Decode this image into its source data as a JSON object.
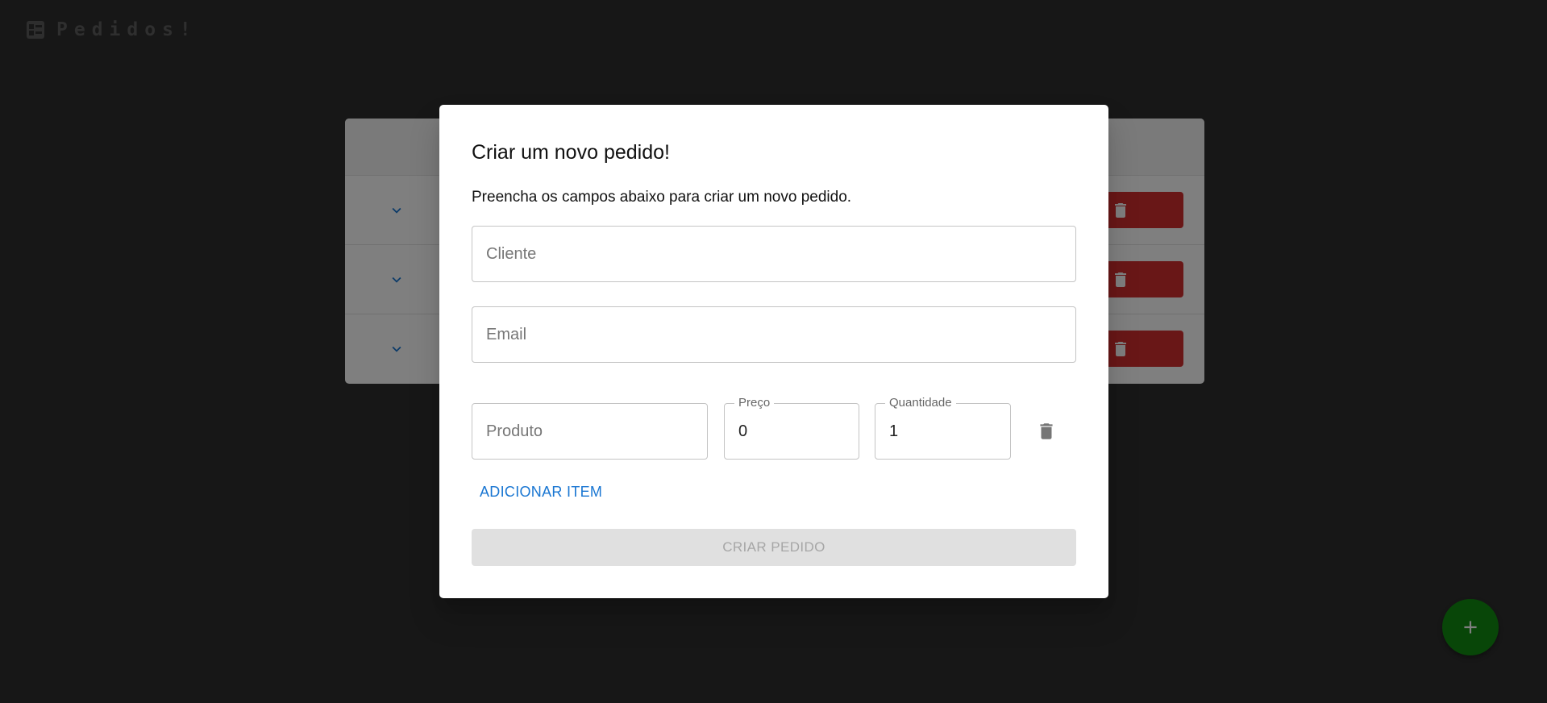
{
  "app": {
    "title": "Pedidos!",
    "icon": "dashboard-list-icon"
  },
  "orders_table": {
    "rows": [
      {
        "expand_icon": "chevron-down-icon",
        "delete_icon": "trash-icon"
      },
      {
        "expand_icon": "chevron-down-icon",
        "delete_icon": "trash-icon"
      },
      {
        "expand_icon": "chevron-down-icon",
        "delete_icon": "trash-icon"
      }
    ]
  },
  "fab": {
    "icon": "plus-icon"
  },
  "dialog": {
    "title": "Criar um novo pedido!",
    "description": "Preencha os campos abaixo para criar um novo pedido.",
    "fields": {
      "cliente": {
        "placeholder": "Cliente",
        "value": ""
      },
      "email": {
        "placeholder": "Email",
        "value": ""
      }
    },
    "item": {
      "produto": {
        "placeholder": "Produto",
        "value": ""
      },
      "preco": {
        "label": "Preço",
        "value": "0"
      },
      "quantidade": {
        "label": "Quantidade",
        "value": "1"
      },
      "delete_icon": "trash-icon"
    },
    "add_item_label": "ADICIONAR ITEM",
    "submit_label": "CRIAR PEDIDO"
  },
  "colors": {
    "background": "#2e2e2e",
    "primary_blue": "#1976d2",
    "delete_red": "#d32f2f",
    "fab_green": "#118c11",
    "disabled_grey": "#e0e0e0"
  }
}
